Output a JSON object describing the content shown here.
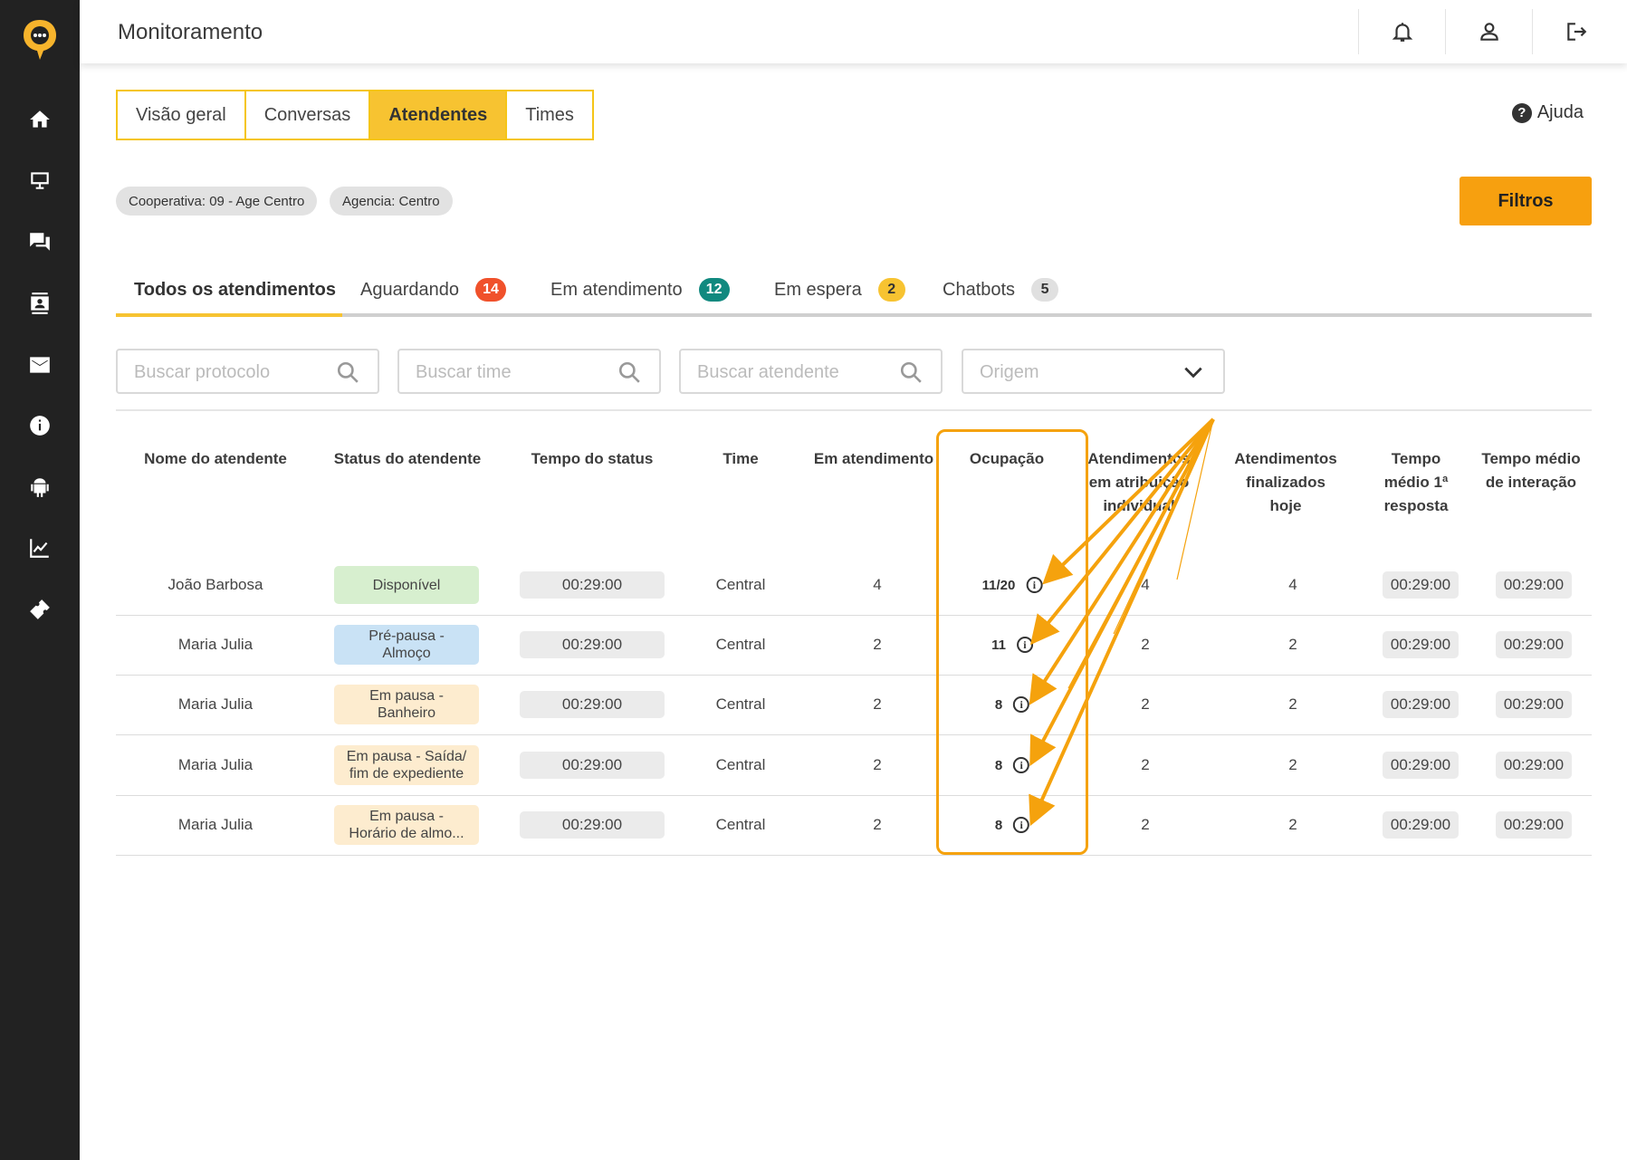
{
  "header": {
    "title": "Monitoramento",
    "icons": [
      "bell-icon",
      "user-icon",
      "logout-icon"
    ]
  },
  "sidebar": {
    "logo": "chat-logo-icon",
    "items": [
      "home-icon",
      "monitor-icon",
      "chat-icon",
      "contacts-icon",
      "mail-icon",
      "info-icon",
      "android-icon",
      "chart-icon",
      "ticket-icon"
    ]
  },
  "top_tabs": [
    "Visão geral",
    "Conversas",
    "Atendentes",
    "Times"
  ],
  "active_top_tab": "Atendentes",
  "help_label": "Ajuda",
  "chips": [
    "Cooperativa: 09 - Age Centro",
    "Agencia: Centro"
  ],
  "filters_button": "Filtros",
  "subtabs": [
    {
      "label": "Todos os atendimentos",
      "badge": null
    },
    {
      "label": "Aguardando",
      "badge": "14",
      "badge_color": "#f0512b",
      "badge_text": "#ffffff"
    },
    {
      "label": "Em atendimento",
      "badge": "12",
      "badge_color": "#11897f",
      "badge_text": "#ffffff"
    },
    {
      "label": "Em espera",
      "badge": "2",
      "badge_color": "#f7c331",
      "badge_text": "#333333"
    },
    {
      "label": "Chatbots",
      "badge": "5",
      "badge_color": "#e0e0e0",
      "badge_text": "#333333"
    }
  ],
  "search": {
    "protocol_placeholder": "Buscar protocolo",
    "team_placeholder": "Buscar time",
    "agent_placeholder": "Buscar atendente",
    "origin_placeholder": "Origem"
  },
  "table": {
    "headers": {
      "name": "Nome do atendente",
      "status": "Status do atendente",
      "status_time": "Tempo do status",
      "team": "Time",
      "in_service": "Em atendimento",
      "occupation": "Ocupação",
      "individual_l1": "Atendimentos",
      "individual_l2": "em atribuição",
      "individual_l3": "individual",
      "finished_l1": "Atendimentos",
      "finished_l2": "finalizados",
      "finished_l3": "hoje",
      "first_resp_l1": "Tempo",
      "first_resp_l2": "médio 1ª",
      "first_resp_l3": "resposta",
      "interaction_l1": "Tempo médio",
      "interaction_l2": "de interação"
    },
    "rows": [
      {
        "name": "João Barbosa",
        "status_l1": "Disponível",
        "status_l2": "",
        "status_bg": "#d7efcf",
        "status_time": "00:29:00",
        "team": "Central",
        "in_service": "4",
        "occupation": "11/20",
        "individual": "4",
        "finished": "4",
        "first_resp": "00:29:00",
        "interaction": "00:29:00"
      },
      {
        "name": "Maria Julia",
        "status_l1": "Pré-pausa -",
        "status_l2": "Almoço",
        "status_bg": "#c9e2f5",
        "status_time": "00:29:00",
        "team": "Central",
        "in_service": "2",
        "occupation": "11",
        "individual": "2",
        "finished": "2",
        "first_resp": "00:29:00",
        "interaction": "00:29:00"
      },
      {
        "name": "Maria Julia",
        "status_l1": "Em pausa -",
        "status_l2": "Banheiro",
        "status_bg": "#fdeccf",
        "status_time": "00:29:00",
        "team": "Central",
        "in_service": "2",
        "occupation": "8",
        "individual": "2",
        "finished": "2",
        "first_resp": "00:29:00",
        "interaction": "00:29:00"
      },
      {
        "name": "Maria Julia",
        "status_l1": "Em pausa - Saída/",
        "status_l2": "fim de expediente",
        "status_bg": "#fdeccf",
        "status_time": "00:29:00",
        "team": "Central",
        "in_service": "2",
        "occupation": "8",
        "individual": "2",
        "finished": "2",
        "first_resp": "00:29:00",
        "interaction": "00:29:00"
      },
      {
        "name": "Maria Julia",
        "status_l1": "Em pausa -",
        "status_l2": "Horário de almo...",
        "status_bg": "#fdeccf",
        "status_time": "00:29:00",
        "team": "Central",
        "in_service": "2",
        "occupation": "8",
        "individual": "2",
        "finished": "2",
        "first_resp": "00:29:00",
        "interaction": "00:29:00"
      }
    ],
    "info_icon": "info-icon"
  },
  "colors": {
    "accent": "#f7c331",
    "filters_button": "#f7a00f",
    "annotation": "#f5a20d",
    "sidebar": "#222222"
  }
}
